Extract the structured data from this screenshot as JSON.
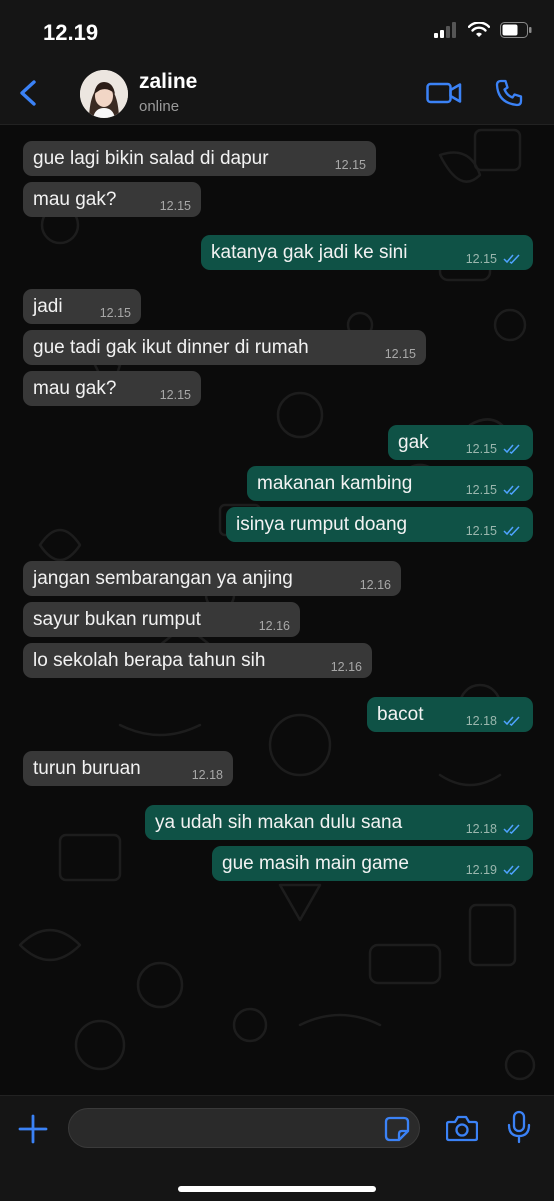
{
  "status_bar": {
    "time": "12.19"
  },
  "contact": {
    "name": "zaline",
    "status": "online"
  },
  "input": {
    "placeholder": "",
    "value": ""
  },
  "colors": {
    "accent": "#3b82f6",
    "incoming": "#383838",
    "outgoing": "#0f5246"
  },
  "icons": {
    "back": "chevron-left-icon",
    "video": "video-camera-icon",
    "phone": "phone-icon",
    "plus": "plus-icon",
    "sticker": "sticker-icon",
    "camera": "camera-icon",
    "mic": "microphone-icon"
  },
  "messages": [
    {
      "dir": "in",
      "text": "gue lagi bikin salad di dapur",
      "time": "12.15"
    },
    {
      "dir": "in",
      "text": "mau gak?",
      "time": "12.15"
    },
    {
      "dir": "out",
      "text": "katanya gak jadi ke sini",
      "time": "12.15",
      "read": true
    },
    {
      "dir": "in",
      "text": "jadi",
      "time": "12.15"
    },
    {
      "dir": "in",
      "text": "gue tadi gak ikut dinner di rumah",
      "time": "12.15"
    },
    {
      "dir": "in",
      "text": "mau gak?",
      "time": "12.15"
    },
    {
      "dir": "out",
      "text": "gak",
      "time": "12.15",
      "read": true
    },
    {
      "dir": "out",
      "text": "makanan kambing",
      "time": "12.15",
      "read": true
    },
    {
      "dir": "out",
      "text": "isinya rumput doang",
      "time": "12.15",
      "read": true
    },
    {
      "dir": "in",
      "text": "jangan sembarangan ya anjing",
      "time": "12.16"
    },
    {
      "dir": "in",
      "text": "sayur bukan rumput",
      "time": "12.16"
    },
    {
      "dir": "in",
      "text": "lo sekolah berapa tahun sih",
      "time": "12.16"
    },
    {
      "dir": "out",
      "text": "bacot",
      "time": "12.18",
      "read": true
    },
    {
      "dir": "in",
      "text": "turun buruan",
      "time": "12.18"
    },
    {
      "dir": "out",
      "text": "ya udah sih makan dulu sana",
      "time": "12.18",
      "read": true
    },
    {
      "dir": "out",
      "text": "gue masih main game",
      "time": "12.19",
      "read": true
    }
  ]
}
